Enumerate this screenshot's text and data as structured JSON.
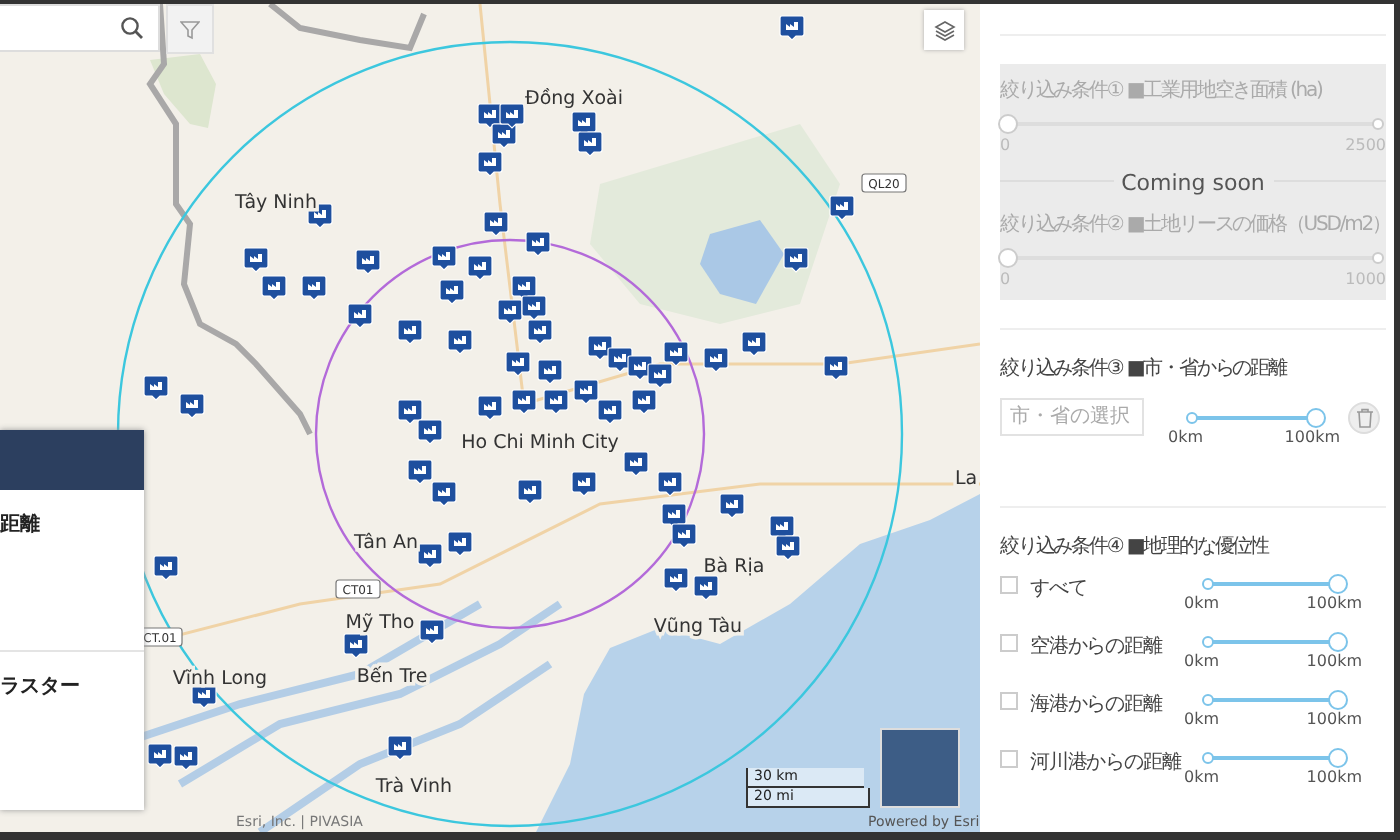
{
  "map": {
    "places": [
      "Đồng Xoài",
      "Tây Ninh",
      "Ho Chi Minh City",
      "Tân An",
      "Mỹ Tho",
      "Vĩnh Long",
      "Bến Tre",
      "Trà Vinh",
      "Bà Rịa",
      "Vũng Tàu",
      "La"
    ],
    "road_labels": [
      "QL20",
      "CT.01",
      "CT01"
    ],
    "scale": [
      "30 km",
      "20 mi"
    ],
    "attribution": "Esri, Inc. | PIVASIA",
    "powered_by": "Powered by Esri"
  },
  "side_overlay": {
    "texts": [
      "距離",
      "ラスター"
    ]
  },
  "filter_panel": {
    "coming_soon": {
      "label": "Coming soon",
      "disabled": true,
      "filters": [
        {
          "title": "絞り込み条件① ■工業用地空き面積 (ha)",
          "min": "0",
          "max": "2500",
          "level": 0
        },
        {
          "title": "絞り込み条件② ■土地リースの価格（USD/m2）",
          "min": "0",
          "max": "1000",
          "level": 0
        }
      ]
    },
    "city_filter": {
      "title": "絞り込み条件③ ■市・省からの距離",
      "placeholder": "市・省の選択",
      "min": "0km",
      "max": "100km",
      "level": 1
    },
    "geo_filter": {
      "title": "絞り込み条件④ ■地理的な優位性",
      "rows": [
        {
          "label": "すべて",
          "checked": false,
          "min": "0km",
          "max": "100km",
          "level": 1
        },
        {
          "label": "空港からの距離",
          "checked": false,
          "min": "0km",
          "max": "100km",
          "level": 1
        },
        {
          "label": "海港からの距離",
          "checked": false,
          "min": "0km",
          "max": "100km",
          "level": 1
        },
        {
          "label": "河川港からの距離",
          "checked": false,
          "min": "0km",
          "max": "100km",
          "level": 1
        }
      ]
    }
  }
}
